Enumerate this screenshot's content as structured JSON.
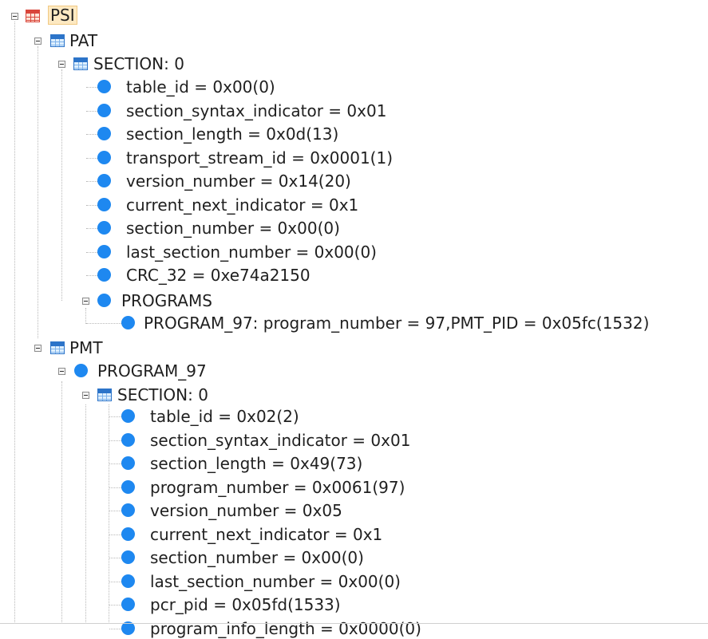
{
  "tree": {
    "root": {
      "label": "PSI",
      "selected": true
    },
    "pat": {
      "label": "PAT",
      "section": {
        "label": "SECTION: 0",
        "fields": [
          "table_id = 0x00(0)",
          "section_syntax_indicator = 0x01",
          "section_length = 0x0d(13)",
          "transport_stream_id = 0x0001(1)",
          "version_number = 0x14(20)",
          "current_next_indicator = 0x1",
          "section_number = 0x00(0)",
          "last_section_number = 0x00(0)",
          "CRC_32 = 0xe74a2150"
        ],
        "programs": {
          "label": "PROGRAMS",
          "items": [
            "PROGRAM_97: program_number = 97,PMT_PID = 0x05fc(1532)"
          ]
        }
      }
    },
    "pmt": {
      "label": "PMT",
      "program": {
        "label": "PROGRAM_97",
        "section": {
          "label": "SECTION: 0",
          "fields": [
            "table_id = 0x02(2)",
            "section_syntax_indicator = 0x01",
            "section_length = 0x49(73)",
            "program_number = 0x0061(97)",
            "version_number = 0x05",
            "current_next_indicator = 0x1",
            "section_number = 0x00(0)",
            "last_section_number = 0x00(0)",
            "pcr_pid = 0x05fd(1533)",
            "program_info_length = 0x0000(0)"
          ]
        }
      }
    }
  },
  "colors": {
    "node_dot": "#1e88f0",
    "table_icon_blue": "#2c74c9",
    "table_icon_red": "#d9463b",
    "selection_bg": "#fde9c2"
  },
  "icons": {
    "toggle": "collapse-toggle-icon",
    "table": "table-icon",
    "psi_table": "table-icon-red",
    "field": "field-dot-icon"
  }
}
